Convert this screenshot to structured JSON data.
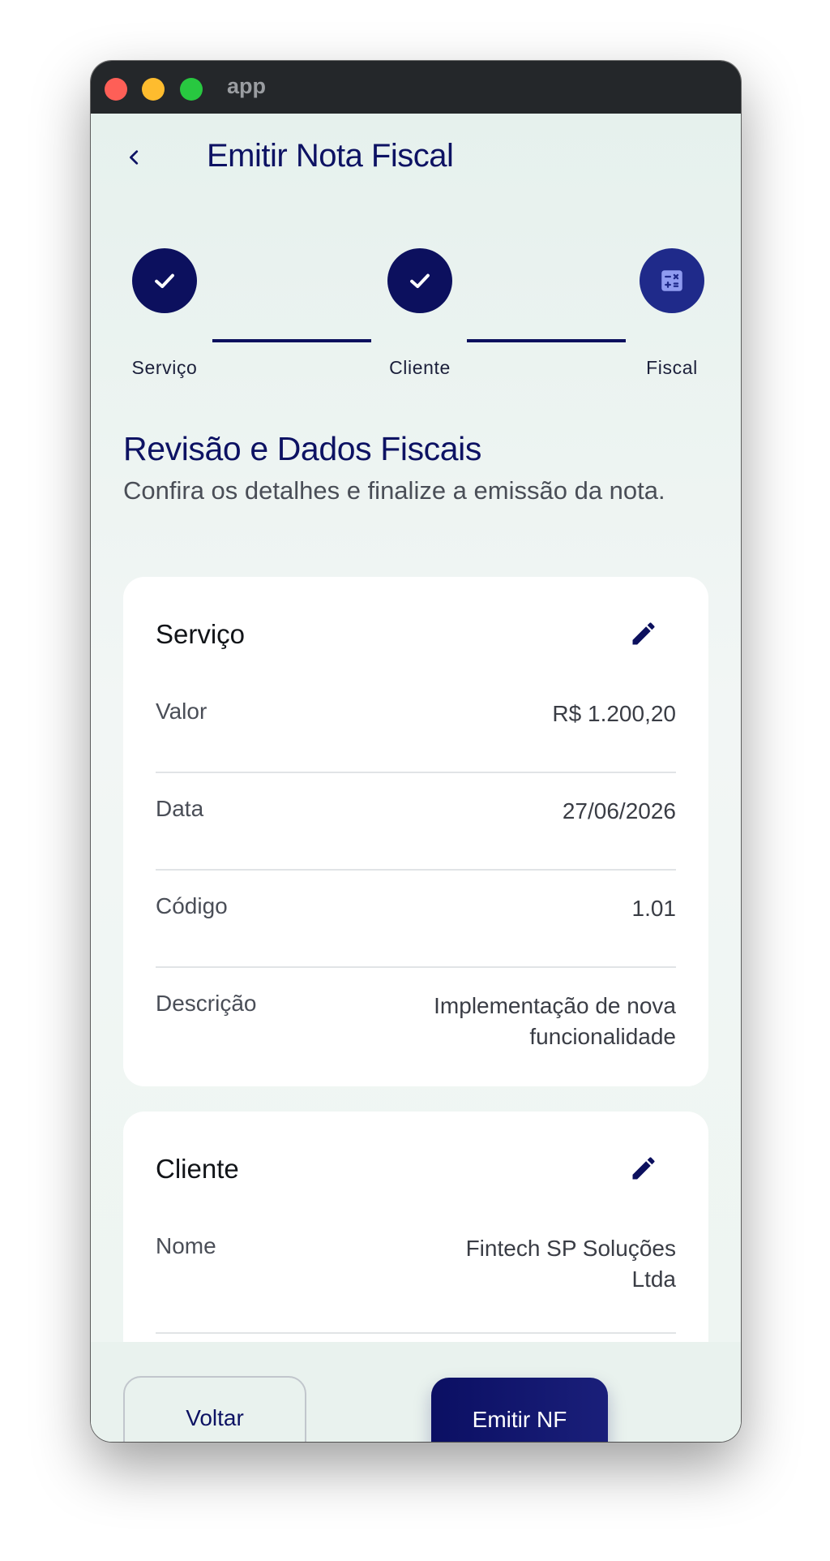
{
  "window": {
    "title": "app"
  },
  "header": {
    "back_icon": "chevron-left-icon",
    "title": "Emitir Nota Fiscal"
  },
  "stepper": {
    "steps": [
      {
        "label": "Serviço",
        "state": "completed",
        "icon": "check-icon"
      },
      {
        "label": "Cliente",
        "state": "completed",
        "icon": "check-icon"
      },
      {
        "label": "Fiscal",
        "state": "current",
        "icon": "calculator-icon"
      }
    ]
  },
  "review": {
    "title": "Revisão e Dados Fiscais",
    "subtitle": "Confira os detalhes e finalize a emissão da nota."
  },
  "service_card": {
    "title": "Serviço",
    "edit_icon": "pencil-icon",
    "rows": [
      {
        "label": "Valor",
        "value": "R$ 1.200,20"
      },
      {
        "label": "Data",
        "value": "27/06/2026"
      },
      {
        "label": "Código",
        "value": "1.01"
      },
      {
        "label": "Descrição",
        "value": "Implementação de nova funcionalidade"
      }
    ]
  },
  "client_card": {
    "title": "Cliente",
    "edit_icon": "pencil-icon",
    "rows": [
      {
        "label": "Nome",
        "value": "Fintech SP Soluções Ltda"
      }
    ]
  },
  "footer": {
    "back_label": "Voltar",
    "submit_label": "Emitir NF"
  },
  "colors": {
    "primary": "#0c105e",
    "background": "#eaf3ef",
    "card": "#ffffff",
    "titlebar": "#24272a"
  }
}
